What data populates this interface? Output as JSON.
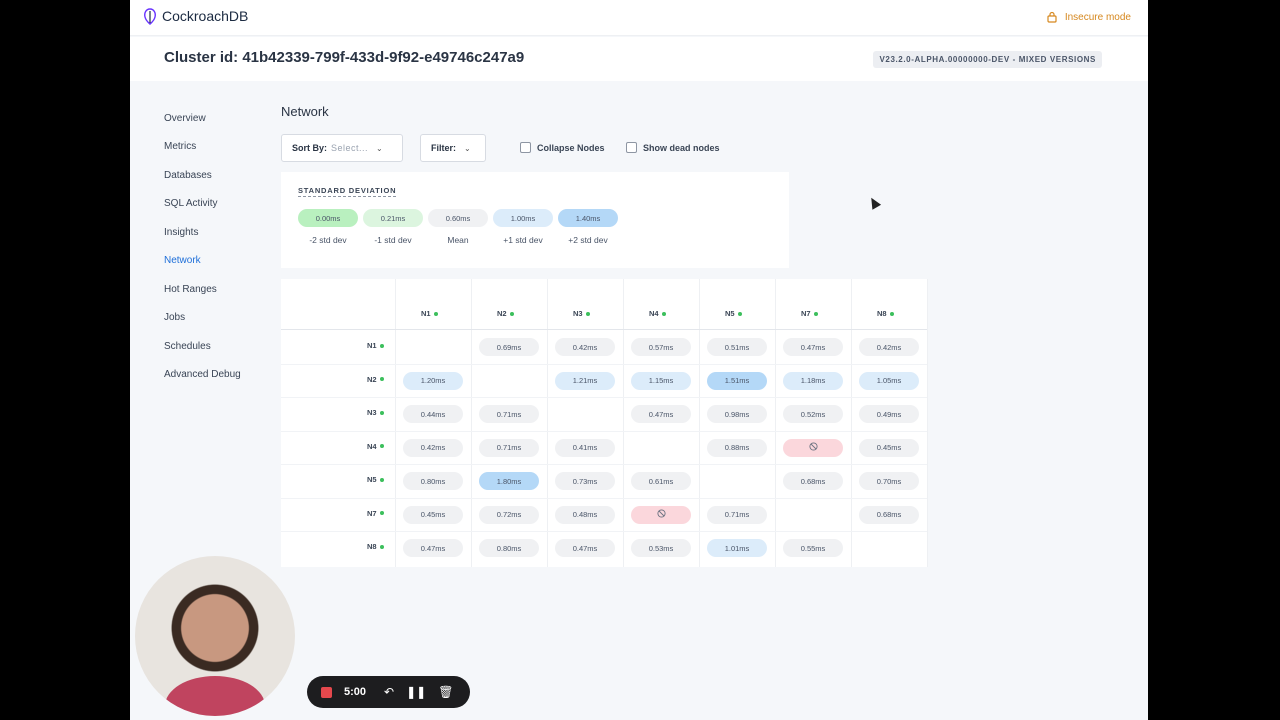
{
  "app": {
    "name": "CockroachDB",
    "insecure_label": "Insecure mode"
  },
  "header": {
    "cluster_id": "Cluster id: 41b42339-799f-433d-9f92-e49746c247a9",
    "version": "V23.2.0-ALPHA.00000000-DEV - MIXED VERSIONS"
  },
  "nav": {
    "items": [
      "Overview",
      "Metrics",
      "Databases",
      "SQL Activity",
      "Insights",
      "Network",
      "Hot Ranges",
      "Jobs",
      "Schedules",
      "Advanced Debug"
    ],
    "active": "Network"
  },
  "page": {
    "title": "Network"
  },
  "controls": {
    "sort_label": "Sort By:",
    "sort_placeholder": "Select...",
    "filter_label": "Filter:",
    "collapse_label": "Collapse Nodes",
    "collapse_checked": false,
    "dead_label": "Show dead nodes",
    "dead_checked": false
  },
  "legend": {
    "title": "STANDARD DEVIATION",
    "items": [
      {
        "value": "0.00ms",
        "label": "-2 std dev",
        "color": "#b9f0bf"
      },
      {
        "value": "0.21ms",
        "label": "-1 std dev",
        "color": "#dcf5df"
      },
      {
        "value": "0.60ms",
        "label": "Mean",
        "color": "#f0f1f3"
      },
      {
        "value": "1.00ms",
        "label": "+1 std dev",
        "color": "#dcecfa"
      },
      {
        "value": "1.40ms",
        "label": "+2 std dev",
        "color": "#b4d8f7"
      }
    ]
  },
  "matrix": {
    "nodes": [
      "N1",
      "N2",
      "N3",
      "N4",
      "N5",
      "N7",
      "N8"
    ],
    "node_status_color": "#3cbf5c",
    "rows": [
      [
        null,
        {
          "v": "0.69ms",
          "t": "neutral"
        },
        {
          "v": "0.42ms",
          "t": "neutral"
        },
        {
          "v": "0.57ms",
          "t": "neutral"
        },
        {
          "v": "0.51ms",
          "t": "neutral"
        },
        {
          "v": "0.47ms",
          "t": "neutral"
        },
        {
          "v": "0.42ms",
          "t": "neutral"
        }
      ],
      [
        {
          "v": "1.20ms",
          "t": "lightblue"
        },
        null,
        {
          "v": "1.21ms",
          "t": "lightblue"
        },
        {
          "v": "1.15ms",
          "t": "lightblue"
        },
        {
          "v": "1.51ms",
          "t": "blue"
        },
        {
          "v": "1.18ms",
          "t": "lightblue"
        },
        {
          "v": "1.05ms",
          "t": "lightblue"
        }
      ],
      [
        {
          "v": "0.44ms",
          "t": "neutral"
        },
        {
          "v": "0.71ms",
          "t": "neutral"
        },
        null,
        {
          "v": "0.47ms",
          "t": "neutral"
        },
        {
          "v": "0.98ms",
          "t": "neutral"
        },
        {
          "v": "0.52ms",
          "t": "neutral"
        },
        {
          "v": "0.49ms",
          "t": "neutral"
        }
      ],
      [
        {
          "v": "0.42ms",
          "t": "neutral"
        },
        {
          "v": "0.71ms",
          "t": "neutral"
        },
        {
          "v": "0.41ms",
          "t": "neutral"
        },
        null,
        {
          "v": "0.88ms",
          "t": "neutral"
        },
        {
          "v": "no-connection-icon",
          "t": "red"
        },
        {
          "v": "0.45ms",
          "t": "neutral"
        }
      ],
      [
        {
          "v": "0.80ms",
          "t": "neutral"
        },
        {
          "v": "1.80ms",
          "t": "blue"
        },
        {
          "v": "0.73ms",
          "t": "neutral"
        },
        {
          "v": "0.61ms",
          "t": "neutral"
        },
        null,
        {
          "v": "0.68ms",
          "t": "neutral"
        },
        {
          "v": "0.70ms",
          "t": "neutral"
        }
      ],
      [
        {
          "v": "0.45ms",
          "t": "neutral"
        },
        {
          "v": "0.72ms",
          "t": "neutral"
        },
        {
          "v": "0.48ms",
          "t": "neutral"
        },
        {
          "v": "no-connection-icon",
          "t": "red"
        },
        {
          "v": "0.71ms",
          "t": "neutral"
        },
        null,
        {
          "v": "0.68ms",
          "t": "neutral"
        }
      ],
      [
        {
          "v": "0.47ms",
          "t": "neutral"
        },
        {
          "v": "0.80ms",
          "t": "neutral"
        },
        {
          "v": "0.47ms",
          "t": "neutral"
        },
        {
          "v": "0.53ms",
          "t": "neutral"
        },
        {
          "v": "1.01ms",
          "t": "lightblue"
        },
        {
          "v": "0.55ms",
          "t": "neutral"
        },
        null
      ]
    ]
  },
  "recorder": {
    "time": "5:00"
  }
}
